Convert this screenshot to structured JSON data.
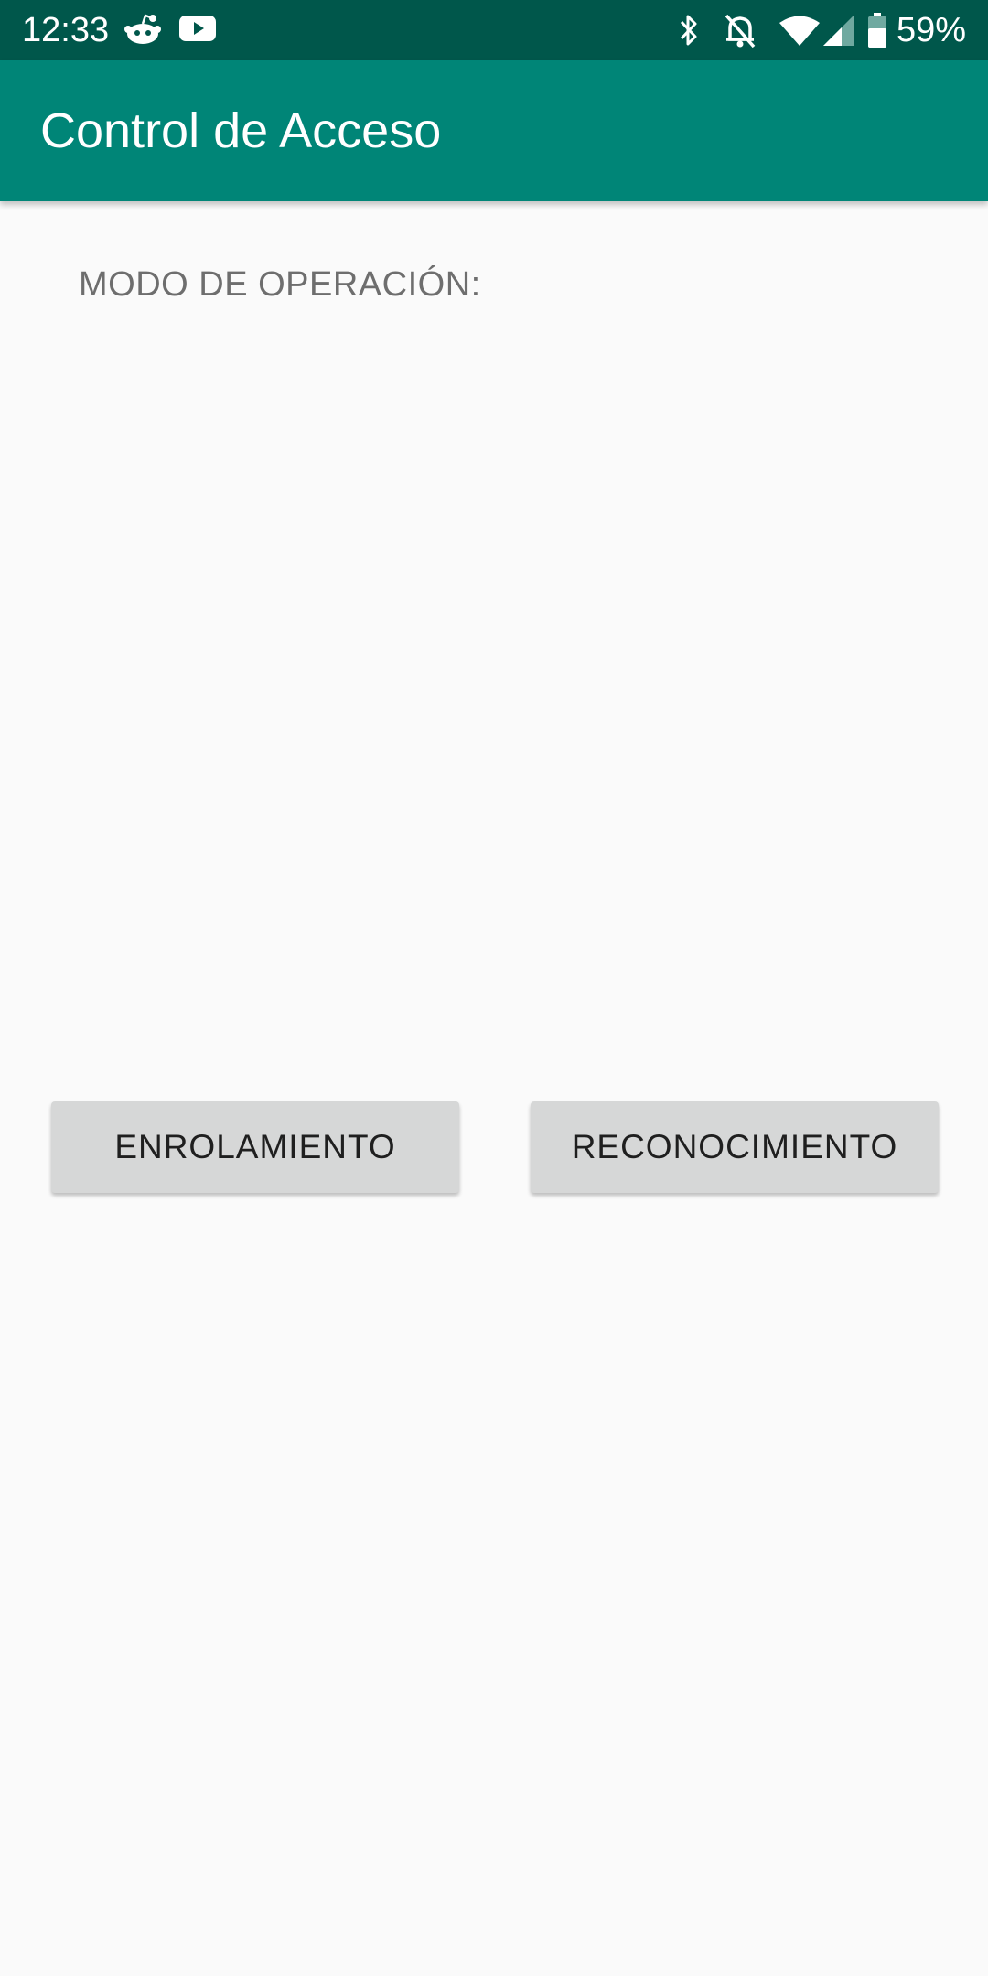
{
  "status_bar": {
    "time": "12:33",
    "battery_percent": "59%",
    "icons": [
      "reddit-icon",
      "youtube-icon",
      "bluetooth-icon",
      "notifications-off-icon",
      "wifi-icon",
      "cell-signal-icon",
      "battery-icon"
    ],
    "background_color": "#00574b"
  },
  "app_bar": {
    "title": "Control de Acceso",
    "background_color": "#008577"
  },
  "main": {
    "mode_label": "MODO DE OPERACIÓN:",
    "buttons": {
      "enrol_label": "ENROLAMIENTO",
      "recognition_label": "RECONOCIMIENTO"
    }
  }
}
